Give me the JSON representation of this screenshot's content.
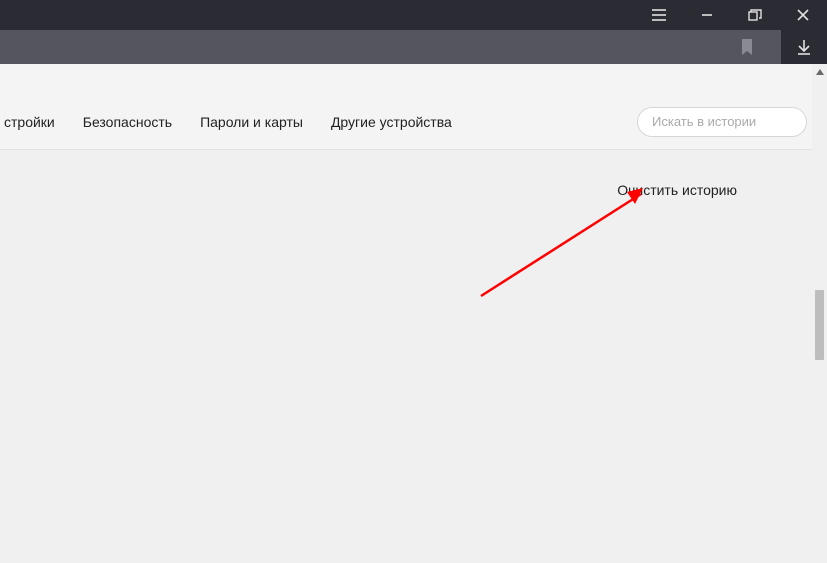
{
  "nav": {
    "items": [
      "стройки",
      "Безопасность",
      "Пароли и карты",
      "Другие устройства"
    ]
  },
  "search": {
    "placeholder": "Искать в истории"
  },
  "content": {
    "clear_history": "Очистить историю"
  }
}
